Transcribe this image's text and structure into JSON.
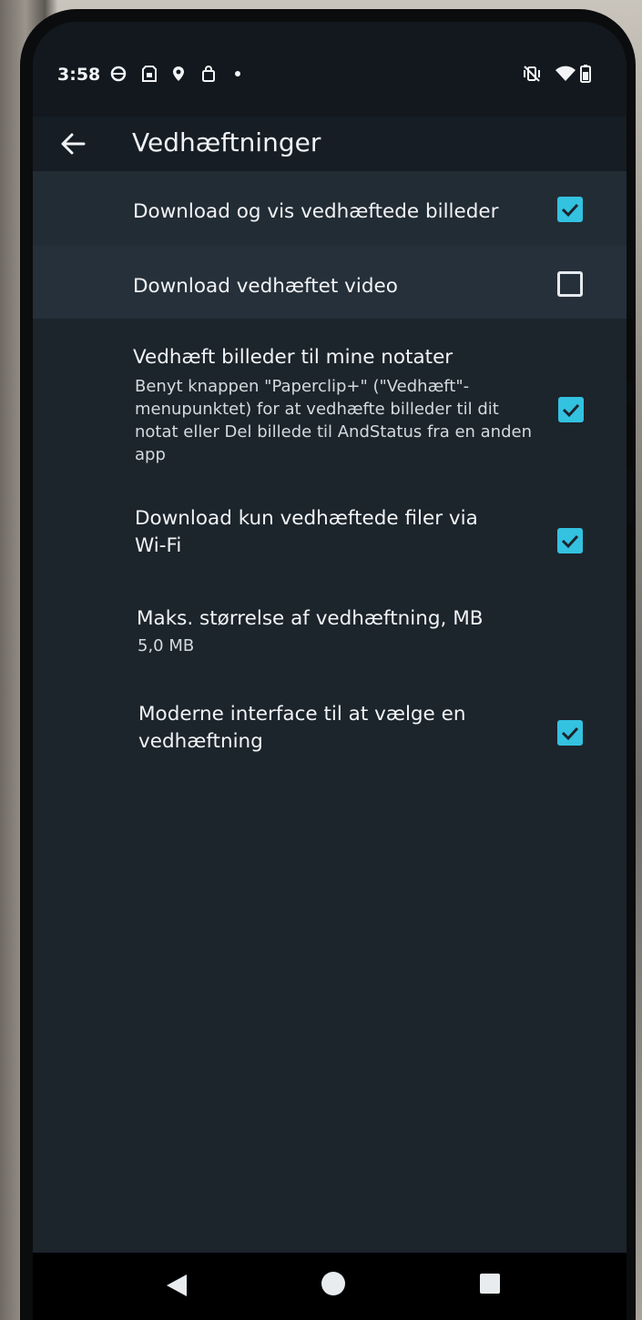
{
  "status_bar": {
    "time": "3:58",
    "left_icons": [
      "circle-icon",
      "sim-card-icon",
      "location-pin-icon",
      "shopping-bag-icon",
      "dot-icon"
    ],
    "right_icons": [
      "vibrate-off-icon",
      "wifi-icon",
      "battery-icon"
    ]
  },
  "app_bar": {
    "back_icon": "arrow-left-icon",
    "title": "Vedhæftninger"
  },
  "settings": [
    {
      "title": "Download og vis vedhæftede billeder",
      "summary": "",
      "checked": true,
      "highlighted": true
    },
    {
      "title": "Download vedhæftet video",
      "summary": "",
      "checked": false,
      "highlighted": true
    },
    {
      "title": "Vedhæft billeder til mine notater",
      "summary": "Benyt knappen \"Paperclip+\" (\"Vedhæft\"-menupunktet) for at vedhæfte billeder til dit notat eller Del billede til AndStatus fra en anden app",
      "checked": true,
      "highlighted": false
    },
    {
      "title": "Download kun vedhæftede filer via Wi-Fi",
      "summary": "",
      "checked": true,
      "highlighted": false
    },
    {
      "title": "Maks. størrelse af vedhæftning, MB",
      "summary": "5,0 MB",
      "checked": null,
      "highlighted": false
    },
    {
      "title": "Moderne interface til at vælge en vedhæftning",
      "summary": "",
      "checked": true,
      "highlighted": false
    }
  ],
  "nav_bar": {
    "icons": [
      "back-triangle-icon",
      "home-circle-icon",
      "recents-square-icon"
    ]
  },
  "colors": {
    "accent": "#33c2e0",
    "background": "#1c242c",
    "status_bar": "#12181e"
  }
}
